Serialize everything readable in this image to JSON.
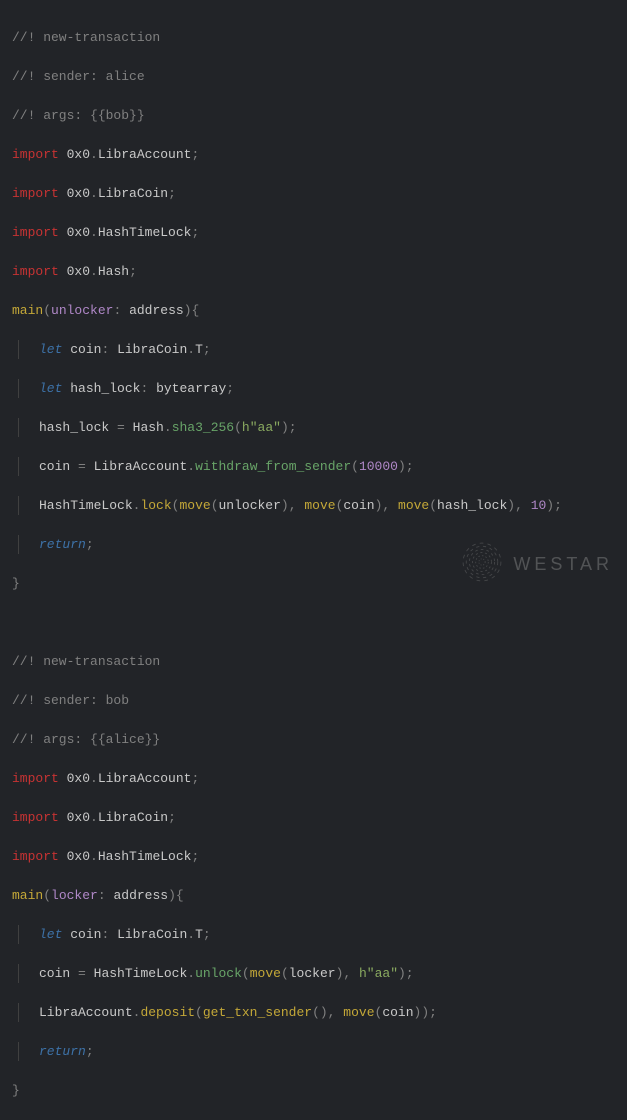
{
  "code": {
    "block1": {
      "c1": "//! new-transaction",
      "c2": "//! sender: alice",
      "c3": "//! args: {{bob}}",
      "imp": "import",
      "mod_prefix": "0x0",
      "m1": "LibraAccount",
      "m2": "LibraCoin",
      "m3": "HashTimeLock",
      "m4": "Hash",
      "main": "main",
      "param_name": "unlocker",
      "param_type": "address",
      "let": "let",
      "v_coin": "coin",
      "t_coin_mod": "LibraCoin",
      "t_coin_t": "T",
      "v_hash": "hash_lock",
      "t_bytearray": "bytearray",
      "hash_mod": "Hash",
      "sha_fn": "sha3_256",
      "hex_str": "h\"aa\"",
      "withdraw_fn": "withdraw_from_sender",
      "withdraw_amt": "10000",
      "lock_fn": "lock",
      "move_fn": "move",
      "lock_timeout": "10",
      "return": "return"
    },
    "block2": {
      "c1": "//! new-transaction",
      "c2": "//! sender: bob",
      "c3": "//! args: {{alice}}",
      "imp": "import",
      "mod_prefix": "0x0",
      "m1": "LibraAccount",
      "m2": "LibraCoin",
      "m3": "HashTimeLock",
      "main": "main",
      "param_name": "locker",
      "param_type": "address",
      "let": "let",
      "v_coin": "coin",
      "t_coin_mod": "LibraCoin",
      "t_coin_t": "T",
      "unlock_fn": "unlock",
      "move_fn": "move",
      "hex_str": "h\"aa\"",
      "deposit_fn": "deposit",
      "get_sender_fn": "get_txn_sender",
      "return": "return"
    }
  },
  "watermark": {
    "text": "WESTAR"
  }
}
